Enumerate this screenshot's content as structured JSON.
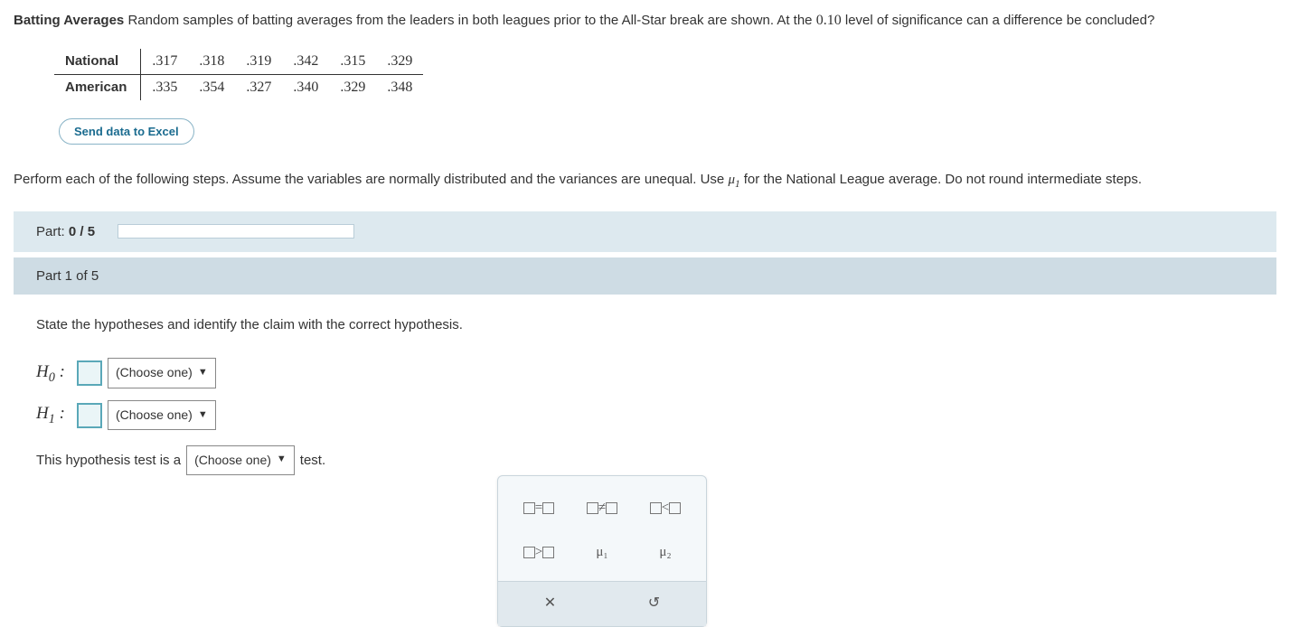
{
  "problem": {
    "title": "Batting Averages",
    "text_1": "Random samples of batting averages from the leaders in both leagues prior to the All-Star break are shown. At the",
    "alpha": "0.10",
    "text_2": "level of significance can a difference be concluded?"
  },
  "data_table": {
    "rows": [
      {
        "label": "National",
        "values": [
          ".317",
          ".318",
          ".319",
          ".342",
          ".315",
          ".329"
        ]
      },
      {
        "label": "American",
        "values": [
          ".335",
          ".354",
          ".327",
          ".340",
          ".329",
          ".348"
        ]
      }
    ]
  },
  "excel_button": "Send data to Excel",
  "instructions": {
    "text_1": "Perform each of the following steps. Assume the variables are normally distributed and the variances are unequal. Use",
    "mu_symbol": "μ",
    "mu_sub": "1",
    "text_2": "for the National League average. Do not round intermediate steps."
  },
  "progress": {
    "label_prefix": "Part: ",
    "label_value": "0 / 5",
    "percent": 0
  },
  "part1": {
    "header": "Part 1 of 5",
    "prompt": "State the hypotheses and identify the claim with the correct hypothesis.",
    "h0_label": "H",
    "h0_sub": "0",
    "h1_label": "H",
    "h1_sub": "1",
    "colon": " :",
    "dropdown_placeholder": "(Choose one)",
    "sentence_1": "This hypothesis test is a",
    "sentence_2": "test."
  },
  "palette": {
    "items": [
      "□=□",
      "□≠□",
      "□<□",
      "□>□",
      "μ₁",
      "μ₂"
    ],
    "clear_icon": "✕",
    "reset_icon": "↺"
  }
}
